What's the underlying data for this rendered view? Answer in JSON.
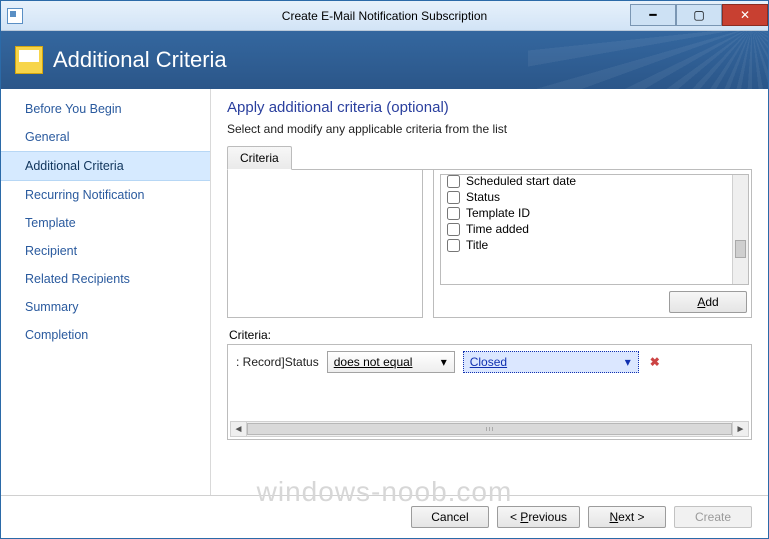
{
  "window": {
    "title": "Create E-Mail Notification Subscription"
  },
  "banner": {
    "title": "Additional Criteria"
  },
  "nav": {
    "items": [
      {
        "label": "Before You Begin"
      },
      {
        "label": "General"
      },
      {
        "label": "Additional Criteria",
        "active": true
      },
      {
        "label": "Recurring Notification"
      },
      {
        "label": "Template"
      },
      {
        "label": "Recipient"
      },
      {
        "label": "Related Recipients"
      },
      {
        "label": "Summary"
      },
      {
        "label": "Completion"
      }
    ]
  },
  "main": {
    "heading": "Apply additional criteria (optional)",
    "instruction": "Select and modify any applicable criteria from the list",
    "tab_label": "Criteria",
    "properties": [
      "Scheduled start date",
      "Status",
      "Template ID",
      "Time added",
      "Title"
    ],
    "add_label": "Add",
    "criteria_label": "Criteria:",
    "row": {
      "field": "Record]Status",
      "operator": "does not equal",
      "value": "Closed"
    }
  },
  "footer": {
    "cancel": "Cancel",
    "previous": "Previous",
    "next": "Next",
    "create": "Create"
  },
  "watermark": "windows-noob.com"
}
